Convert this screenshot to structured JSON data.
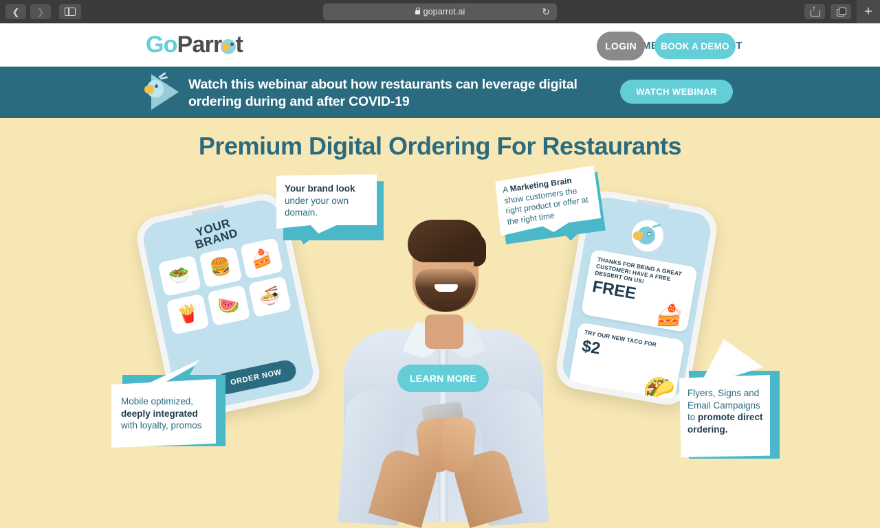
{
  "browser": {
    "back_icon": "chevron-left-icon",
    "forward_icon": "chevron-right-icon",
    "sidebar_icon": "sidebar-toggle-icon",
    "lock_icon": "lock-icon",
    "url": "goparrot.ai",
    "reload_icon": "↻",
    "share_icon": "share-icon",
    "tabs_icon": "tab-overview-icon",
    "newtab_label": "+"
  },
  "header": {
    "logo_go": "Go",
    "logo_parrot": "Parr",
    "logo_parrot_tail": "t",
    "nav": [
      {
        "label": "CUSTOMERS"
      },
      {
        "label": "CONTACT"
      }
    ],
    "login_label": "LOGIN",
    "demo_label": "BOOK A DEMO"
  },
  "webinar": {
    "text": "Watch this webinar about how restaurants can leverage digital ordering during and after COVID-19",
    "button_label": "WATCH WEBINAR",
    "bird_icon": "parrot-play-icon"
  },
  "hero": {
    "title": "Premium Digital Ordering For Restaurants",
    "cta_label": "LEARN MORE"
  },
  "phone_left": {
    "brand_line1": "YOUR",
    "brand_line2": "BRAND",
    "tiles": [
      {
        "icon": "salad-bowl-icon",
        "glyph": "🥗"
      },
      {
        "icon": "burger-drink-icon",
        "glyph": "🍔"
      },
      {
        "icon": "cake-slice-icon",
        "glyph": "🍰"
      },
      {
        "icon": "fries-icon",
        "glyph": "🍟"
      },
      {
        "icon": "watermelon-icon",
        "glyph": "🍉"
      },
      {
        "icon": "noodle-bowl-icon",
        "glyph": "🍜"
      }
    ],
    "order_label": "ORDER NOW"
  },
  "phone_right": {
    "avatar_icon": "parrot-avatar-icon",
    "card_one_text": "THANKS FOR BEING A GREAT CUSTOMER! HAVE A FREE DESSERT ON US!",
    "card_one_big": "FREE",
    "card_one_emoji": "🍰",
    "card_two_text": "TRY OUR NEW TACO FOR",
    "card_two_big": "$2",
    "card_two_emoji": "🌮"
  },
  "bubbles": {
    "brand": {
      "bold": "Your brand look",
      "rest": "under your own domain."
    },
    "marketing": {
      "pre": "A ",
      "bold": "Marketing Brain",
      "rest": "show customers the right product or offer at the right time"
    },
    "mobile": {
      "pre": "Mobile optimized,",
      "bold": "deeply integrated",
      "rest": "with loyalty, promos"
    },
    "flyers": {
      "pre": "Flyers, Signs and Email Campaigns to ",
      "bold": "promote direct ordering."
    }
  },
  "colors": {
    "teal_dark": "#2a6b80",
    "cyan": "#63cdd8",
    "cyan_shadow": "#4ab8c9",
    "cream": "#f7e7b4",
    "gray_button": "#8a8a8a",
    "ink": "#1f3b4d"
  }
}
